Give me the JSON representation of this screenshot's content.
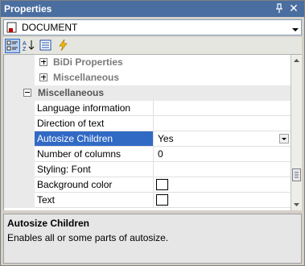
{
  "window": {
    "title": "Properties"
  },
  "object_selector": {
    "value": "DOCUMENT"
  },
  "toolbar": {
    "buttons": [
      {
        "name": "categorized-icon",
        "active": true
      },
      {
        "name": "alphabetical-icon",
        "active": false
      },
      {
        "name": "property-pages-icon",
        "active": false
      },
      {
        "name": "events-icon",
        "active": false
      }
    ]
  },
  "grid": {
    "categories": {
      "bidi": {
        "label": "BiDi Properties"
      },
      "misc_collapsed": {
        "label": "Miscellaneous"
      },
      "misc_expanded": {
        "label": "Miscellaneous"
      }
    },
    "properties": [
      {
        "name": "Language information",
        "value": ""
      },
      {
        "name": "Direction of text",
        "value": ""
      },
      {
        "name": "Autosize Children",
        "value": "Yes"
      },
      {
        "name": "Number of columns",
        "value": "0"
      },
      {
        "name": "Styling: Font",
        "value": ""
      },
      {
        "name": "Background color",
        "value": ""
      },
      {
        "name": "Text",
        "value": ""
      }
    ],
    "selected": "Autosize Children"
  },
  "description": {
    "title": "Autosize Children",
    "text": "Enables all or some parts of autosize."
  }
}
